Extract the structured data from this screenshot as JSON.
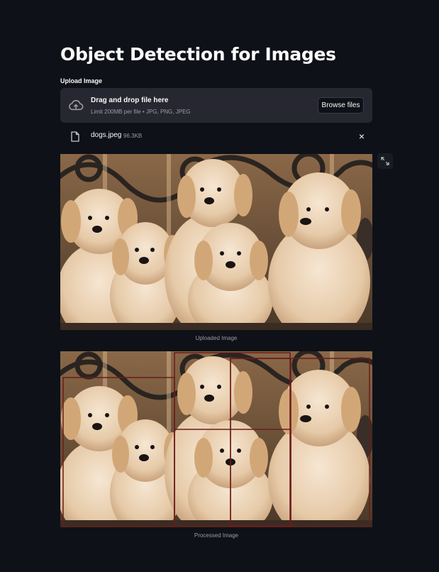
{
  "page": {
    "title": "Object Detection for Images"
  },
  "uploader": {
    "label": "Upload Image",
    "drop_text": "Drag and drop file here",
    "limit_text": "Limit 200MB per file • JPG, PNG, JPEG",
    "browse_label": "Browse files",
    "upload_icon": "cloud-upload-icon"
  },
  "file": {
    "name": "dogs.jpeg",
    "size": "96.3KB",
    "file_icon": "file-icon",
    "remove_icon": "close-icon"
  },
  "images": {
    "uploaded_caption": "Uploaded Image",
    "processed_caption": "Processed Image",
    "expand_icon": "fullscreen-icon"
  },
  "colors": {
    "background": "#0e1117",
    "dropzone": "#262730",
    "box": "#6b1c1c"
  }
}
